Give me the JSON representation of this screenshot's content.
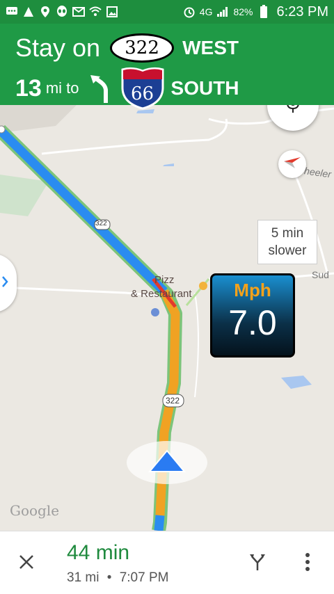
{
  "status_bar": {
    "battery_text": "82%",
    "network_text": "4G",
    "time": "6:23 PM",
    "icons": [
      "chat-icon",
      "warning-icon",
      "location-icon",
      "alien-icon",
      "mail-icon",
      "wifi-icon",
      "image-icon",
      "alarm-icon",
      "signal-icon",
      "battery-icon"
    ]
  },
  "instruction": {
    "line1_prefix": "Stay on",
    "route1": "322",
    "direction1": "WEST",
    "distance_value": "13",
    "distance_unit": "mi to",
    "turn": "slight-left",
    "route2": "66",
    "direction2": "SOUTH"
  },
  "map": {
    "road_shield": "322",
    "poi_label_line1": "Pizz",
    "poi_label_line2": "& Restaurant",
    "street_label_right": "Wheeler",
    "street_label_sud": "Sud",
    "traffic_callout_line1": "5 min",
    "traffic_callout_line2": "slower",
    "speed_unit": "Mph",
    "speed_value": "7.0",
    "attribution": "Google"
  },
  "trip": {
    "eta_duration": "44 min",
    "remaining_distance": "31 mi",
    "separator": "•",
    "arrival_time": "7:07 PM"
  },
  "colors": {
    "header_green": "#1f9a46",
    "status_green": "#1e8e3e",
    "route_blue": "#2a8cf0",
    "traffic_orange": "#f0a223",
    "eta_green": "#1f8a3e"
  }
}
